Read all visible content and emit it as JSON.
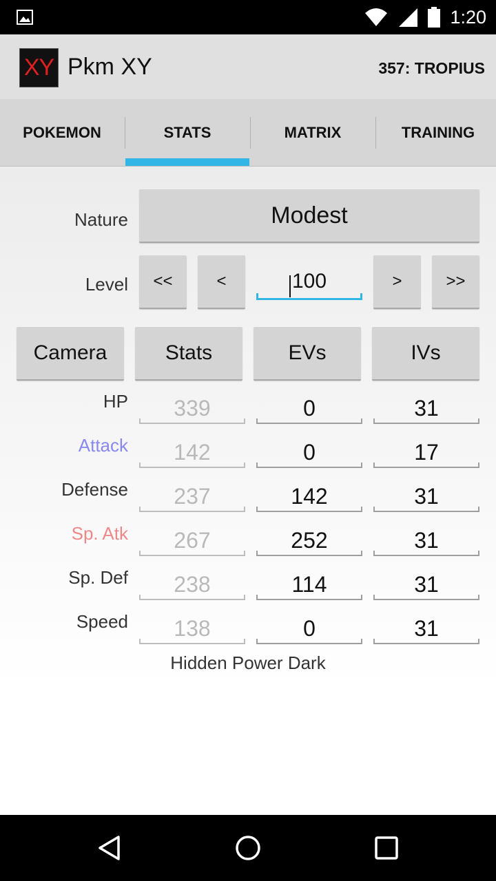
{
  "status_bar": {
    "time": "1:20",
    "icons": [
      "image-icon",
      "wifi-icon",
      "signal-icon",
      "battery-icon"
    ]
  },
  "action_bar": {
    "app_icon_text": "XY",
    "app_title": "Pkm XY",
    "pokemon": "357: TROPIUS"
  },
  "tabs": [
    {
      "label": "POKEMON",
      "selected": false
    },
    {
      "label": "STATS",
      "selected": true
    },
    {
      "label": "MATRIX",
      "selected": false
    },
    {
      "label": "TRAINING",
      "selected": false
    }
  ],
  "nature": {
    "label": "Nature",
    "value": "Modest"
  },
  "level": {
    "label": "Level",
    "value": "100",
    "buttons": [
      "<<",
      "<",
      ">",
      ">>"
    ]
  },
  "columns": [
    "Camera",
    "Stats",
    "EVs",
    "IVs"
  ],
  "stats": [
    {
      "name": "HP",
      "color": "#333333",
      "stat": "339",
      "ev": "0",
      "iv": "31"
    },
    {
      "name": "Attack",
      "color": "#8888ee",
      "stat": "142",
      "ev": "0",
      "iv": "17"
    },
    {
      "name": "Defense",
      "color": "#333333",
      "stat": "237",
      "ev": "142",
      "iv": "31"
    },
    {
      "name": "Sp. Atk",
      "color": "#ee8888",
      "stat": "267",
      "ev": "252",
      "iv": "31"
    },
    {
      "name": "Sp. Def",
      "color": "#333333",
      "stat": "238",
      "ev": "114",
      "iv": "31"
    },
    {
      "name": "Speed",
      "color": "#333333",
      "stat": "138",
      "ev": "0",
      "iv": "31"
    }
  ],
  "hidden_power": "Hidden Power Dark",
  "colors": {
    "accent": "#33b5e5",
    "app_icon_text": "#e02020"
  },
  "nav_bar": {
    "icons": [
      "back-icon",
      "home-icon",
      "recents-icon"
    ]
  }
}
